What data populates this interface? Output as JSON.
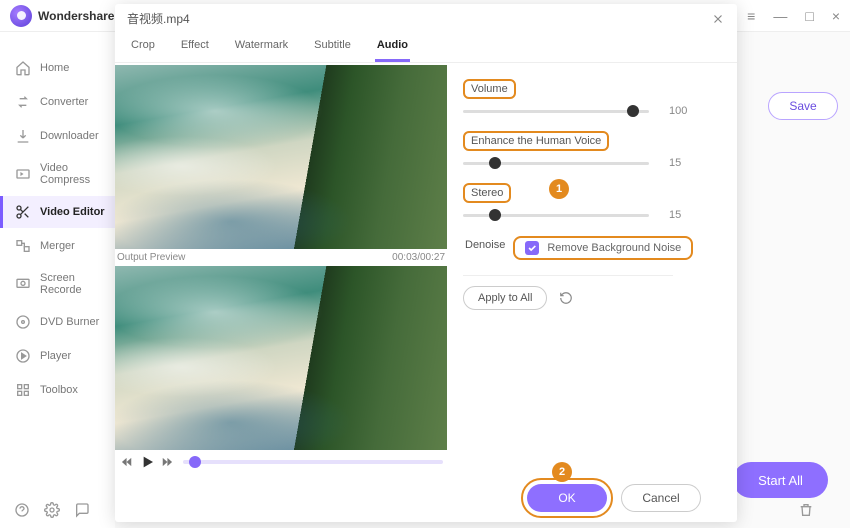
{
  "app": {
    "brand": "Wondershare"
  },
  "window_controls": {
    "menu": "≡",
    "min": "—",
    "max": "□",
    "close": "×"
  },
  "sidebar": {
    "items": [
      {
        "label": "Home"
      },
      {
        "label": "Converter"
      },
      {
        "label": "Downloader"
      },
      {
        "label": "Video Compress"
      },
      {
        "label": "Video Editor"
      },
      {
        "label": "Merger"
      },
      {
        "label": "Screen Recorde"
      },
      {
        "label": "DVD Burner"
      },
      {
        "label": "Player"
      },
      {
        "label": "Toolbox"
      }
    ]
  },
  "main": {
    "save_label": "Save",
    "start_all_label": "Start All"
  },
  "modal": {
    "title": "音视频.mp4",
    "tabs": [
      {
        "label": "Crop"
      },
      {
        "label": "Effect"
      },
      {
        "label": "Watermark"
      },
      {
        "label": "Subtitle"
      },
      {
        "label": "Audio"
      }
    ],
    "preview": {
      "output_label": "Output Preview",
      "time": "00:03/00:27"
    },
    "controls": {
      "volume": {
        "label": "Volume",
        "value": "100",
        "pos": 88
      },
      "enhance": {
        "label": "Enhance the Human Voice",
        "value": "15",
        "pos": 14
      },
      "stereo": {
        "label": "Stereo",
        "value": "15",
        "pos": 14
      },
      "denoise_label": "Denoise",
      "remove_noise_label": "Remove Background Noise",
      "apply_all_label": "Apply to All"
    },
    "annotations": {
      "step1": "1",
      "step2": "2"
    },
    "footer": {
      "ok": "OK",
      "cancel": "Cancel"
    }
  }
}
